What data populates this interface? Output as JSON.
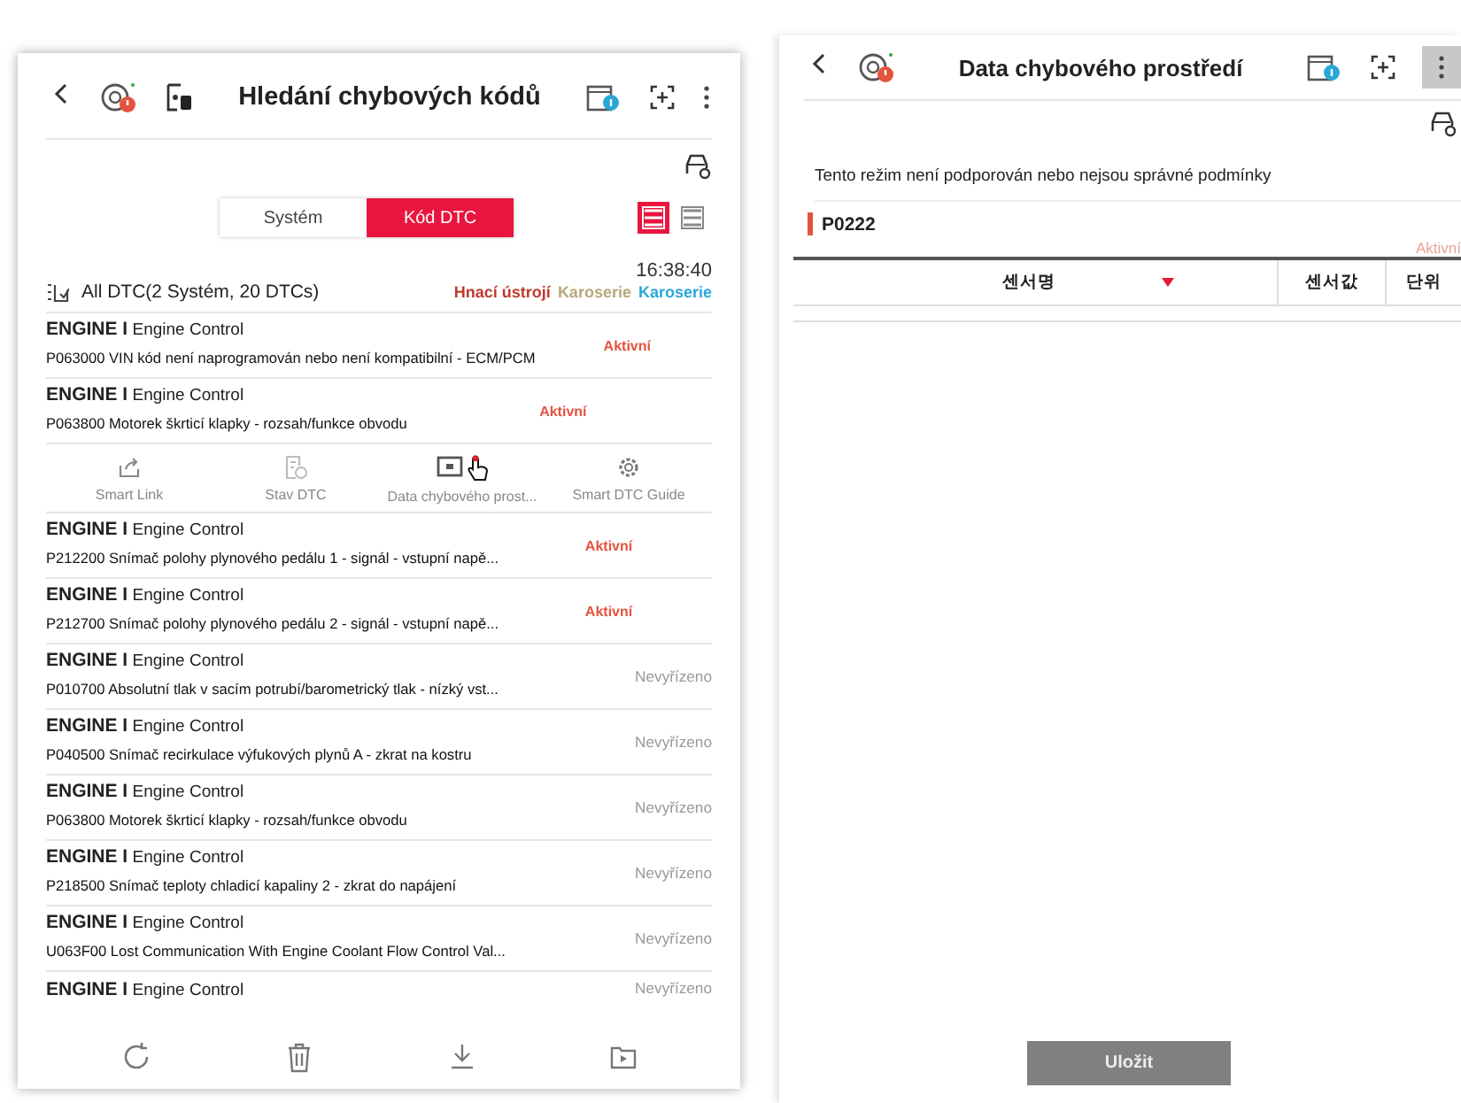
{
  "left_screen": {
    "title": "Hledání chybových kódů",
    "tabs": [
      {
        "label": "Systém",
        "selected": false
      },
      {
        "label": "Kód DTC",
        "selected": true
      }
    ],
    "view_modes": [
      {
        "selected": true
      },
      {
        "selected": false
      }
    ],
    "time": "16:38:40",
    "summary": "All DTC(2 Systém, 20 DTCs)",
    "categories": [
      {
        "label": "Hnací ústrojí",
        "color": "#c0392b"
      },
      {
        "label": "Karoserie",
        "color": "#b9a77a"
      },
      {
        "label": "Karoserie",
        "color": "#2aa7d8"
      }
    ],
    "rows": [
      {
        "kind": "dtc",
        "title": "**ENGINE I** Engine Control",
        "description": "P063000 VIN kód není naprogramován nebo není kompatibilní - ECM/PCM",
        "status": "Aktivní",
        "active": true
      },
      {
        "kind": "dtc",
        "title": "**ENGINE I** Engine Control",
        "description": "P063800 Motorek škrticí klapky - rozsah/funkce obvodu",
        "status": "Aktivní",
        "active": true
      },
      {
        "kind": "actions",
        "actions": [
          {
            "label": "Smart Link"
          },
          {
            "label": "Stav DTC"
          },
          {
            "label": "Data chybového prost..."
          },
          {
            "label": "Smart DTC Guide"
          }
        ]
      },
      {
        "kind": "dtc",
        "title": "**ENGINE I** Engine Control",
        "description": "P212200 Snímač polohy plynového pedálu 1 - signál - vstupní napě...",
        "status": "Aktivní",
        "active": true
      },
      {
        "kind": "dtc",
        "title": "**ENGINE I** Engine Control",
        "description": "P212700 Snímač polohy plynového pedálu 2 - signál - vstupní napě...",
        "status": "Aktivní",
        "active": true
      },
      {
        "kind": "dtc",
        "title": "**ENGINE I** Engine Control",
        "description": "P010700 Absolutní tlak v sacím potrubí/barometrický tlak - nízký vst...",
        "status": "Nevyřízeno",
        "active": false
      },
      {
        "kind": "dtc",
        "title": "**ENGINE I** Engine Control",
        "description": "P040500 Snímač recirkulace výfukových plynů A - zkrat na kostru",
        "status": "Nevyřízeno",
        "active": false
      },
      {
        "kind": "dtc",
        "title": "**ENGINE I** Engine Control",
        "description": "P063800 Motorek škrticí klapky - rozsah/funkce obvodu",
        "status": "Nevyřízeno",
        "active": false
      },
      {
        "kind": "dtc",
        "title": "**ENGINE I** Engine Control",
        "description": "P218500 Snímač teploty chladicí kapaliny 2 - zkrat do napájení",
        "status": "Nevyřízeno",
        "active": false
      },
      {
        "kind": "dtc",
        "title": "**ENGINE I** Engine Control",
        "description": "U063F00 Lost Communication With Engine Coolant Flow Control Val...",
        "status": "Nevyřízeno",
        "active": false
      },
      {
        "kind": "dtc",
        "title": "**ENGINE I** Engine Control",
        "status": "Nevyřízeno",
        "active": false
      }
    ]
  },
  "right_screen": {
    "title": "Data chybového prostředí",
    "message": "Tento režim není podporován nebo nejsou správné podmínky",
    "dtc_code": "P0222",
    "dtc_status": "Aktivní",
    "table": {
      "columns": [
        "센서명",
        "센서값",
        "단위"
      ]
    },
    "save_button": "Uložit"
  }
}
